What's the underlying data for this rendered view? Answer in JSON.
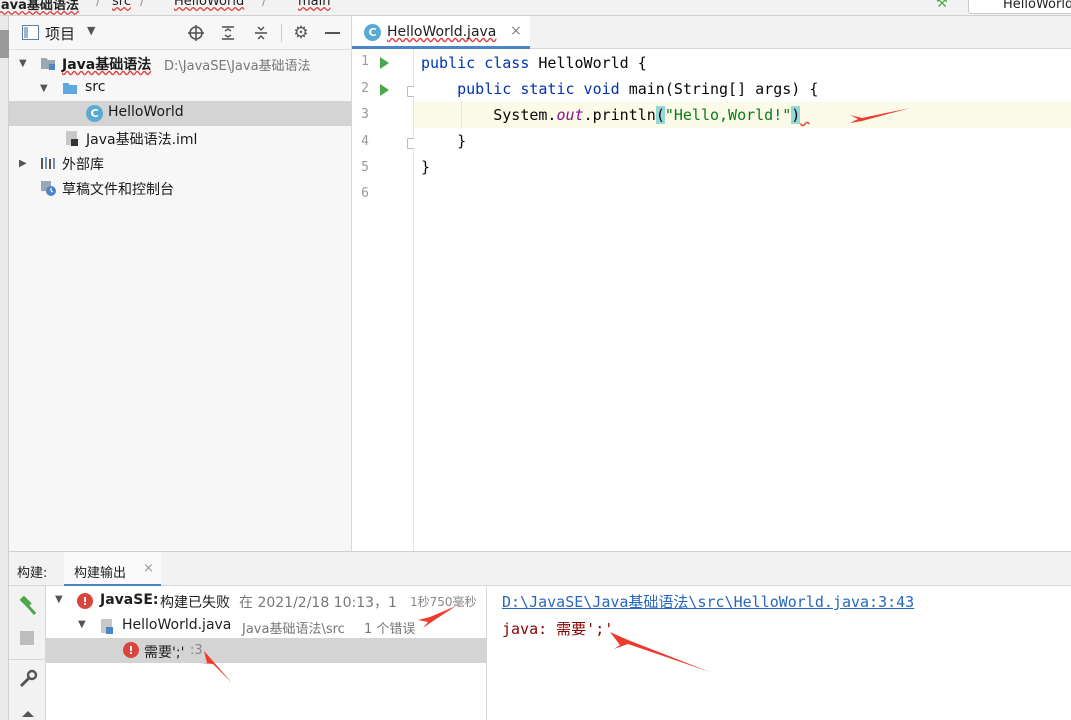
{
  "breadcrumb": {
    "project": "Java基础语法",
    "src": "src",
    "file": "HelloWorld",
    "method": "main",
    "right_tab": "HelloWorld"
  },
  "project_panel": {
    "title": "项目",
    "tree": [
      {
        "label": "Java基础语法",
        "path": "D:\\JavaSE\\Java基础语法"
      },
      {
        "label": "src"
      },
      {
        "label": "HelloWorld"
      },
      {
        "label": "Java基础语法.iml"
      },
      {
        "label": "外部库"
      },
      {
        "label": "草稿文件和控制台"
      }
    ]
  },
  "editor": {
    "tab_label": "HelloWorld.java",
    "line_numbers": [
      "1",
      "2",
      "3",
      "4",
      "5",
      "6"
    ]
  },
  "build": {
    "tab_build": "构建:",
    "tab_output": "构建输出",
    "root": {
      "name": "JavaSE:",
      "status": "构建已失败",
      "time": "在 2021/2/18 10:13，1",
      "duration": "1秒750毫秒"
    },
    "file": {
      "name": "HelloWorld.java",
      "path": "Java基础语法\\src",
      "count": "1 个错误"
    },
    "error": {
      "message": "需要';'",
      "line": ":3"
    },
    "output_link": "D:\\JavaSE\\Java基础语法\\src\\HelloWorld.java:3:43",
    "output_message": "java: 需要';'"
  },
  "colors": {
    "keyword": "#0033b3",
    "string": "#067d17",
    "error": "#d9453d",
    "annotation_arrow": "#ee3b2e"
  }
}
